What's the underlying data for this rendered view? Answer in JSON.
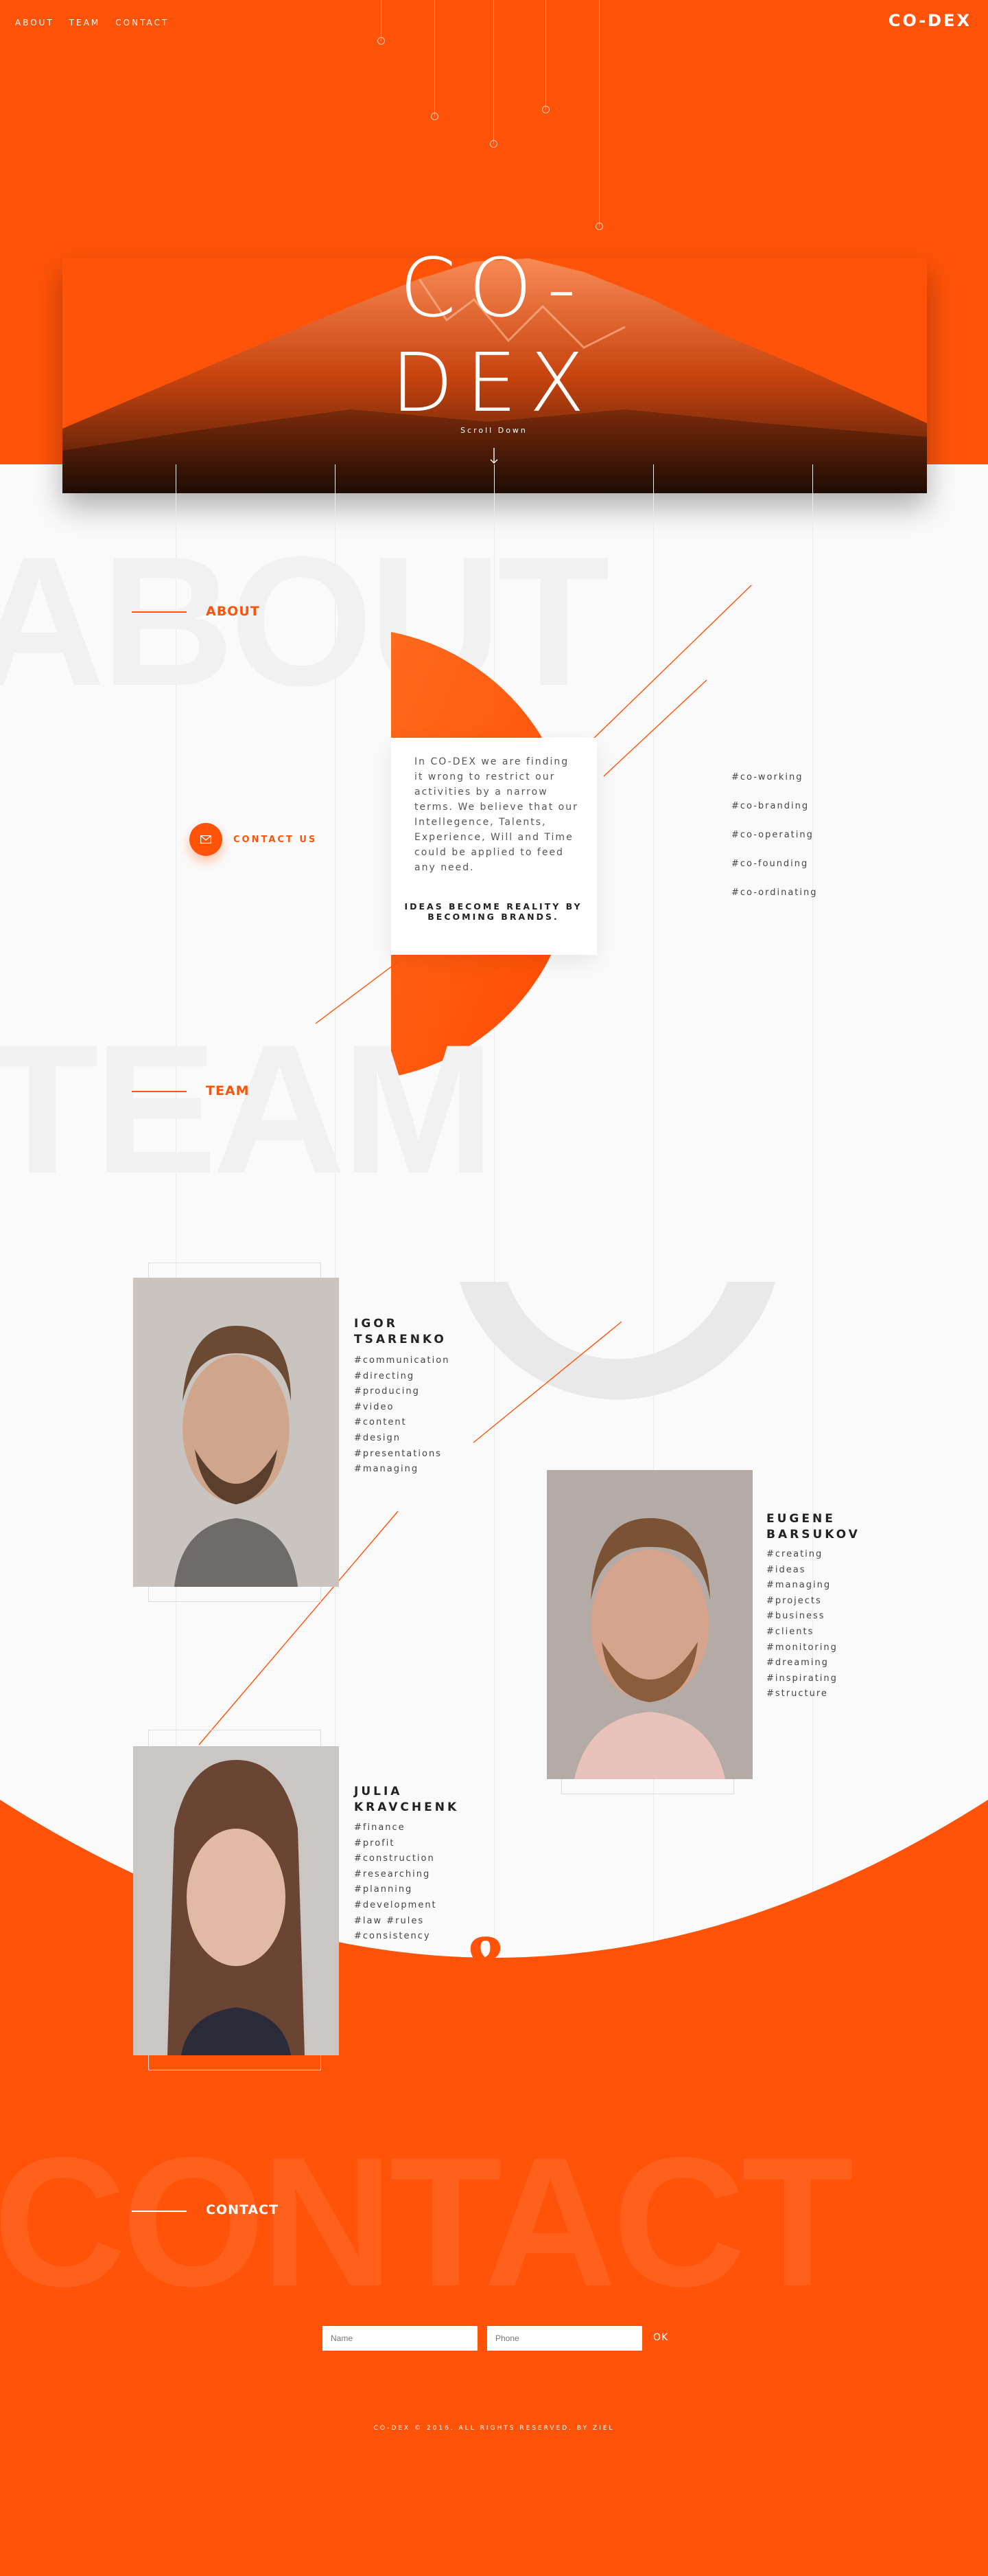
{
  "nav": {
    "items": [
      "ABOUT",
      "TEAM",
      "CONTACT"
    ]
  },
  "brand": {
    "logo": "CO-DEX",
    "hero_logo": "CO-DEX"
  },
  "hero": {
    "scroll_label": "Scroll Down"
  },
  "about": {
    "big_word": "ABOUT",
    "label": "ABOUT",
    "body": "In CO-DEX we are finding it wrong to restrict our activities by a narrow terms. We believe that our Intellegence, Talents, Experience, Will and Time could be applied to feed any need.",
    "tagline": "IDEAS BECOME REALITY BY BECOMING BRANDS.",
    "contact_label": "CONTACT US",
    "hashtags": [
      "#co-working",
      "#co-branding",
      "#co-operating",
      "#co-founding",
      "#co-ordinating"
    ]
  },
  "team": {
    "big_word": "TEAM",
    "label": "TEAM",
    "ampersand": "&",
    "members": [
      {
        "name_line1": "IGOR",
        "name_line2": "TSARENKO",
        "tags": [
          "#communication",
          "#directing",
          "#producing",
          "#video",
          "#content",
          "#design",
          "#presentations",
          "#managing"
        ]
      },
      {
        "name_line1": "EUGENE",
        "name_line2": "BARSUKOV",
        "tags": [
          "#creating",
          "#ideas",
          "#managing",
          "#projects",
          "#business",
          "#clients",
          "#monitoring",
          "#dreaming",
          "#inspirating",
          "#structure"
        ]
      },
      {
        "name_line1": "JULIA",
        "name_line2": "KRAVCHENK",
        "tags": [
          "#finance",
          "#profit",
          "#construction",
          "#researching",
          "#planning",
          "#development",
          "#law #rules",
          "#consistency"
        ]
      }
    ]
  },
  "contact": {
    "big_word": "CONTACT",
    "label": "CONTACT",
    "name_placeholder": "Name",
    "phone_placeholder": "Phone",
    "submit_label": "OK"
  },
  "footer": {
    "text": "CO-DEX © 2016. ALL RIGHTS RESERVED.    BY ZIEL"
  },
  "colors": {
    "accent": "#ff5309",
    "background": "#fafafa",
    "text": "#222222"
  },
  "icons": {
    "scroll": "arrow-down-icon",
    "contact": "envelope-icon"
  }
}
